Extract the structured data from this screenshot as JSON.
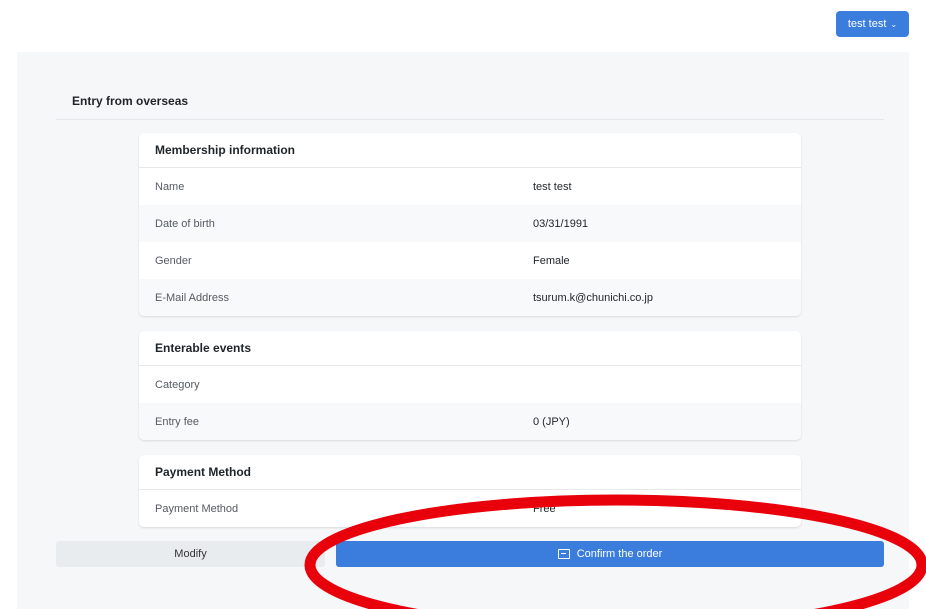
{
  "header": {
    "user_menu_label": "test test",
    "user_menu_chevron": "⌄"
  },
  "page": {
    "title": "Entry from overseas"
  },
  "membership": {
    "title": "Membership information",
    "rows": [
      {
        "label": "Name",
        "value": "test test"
      },
      {
        "label": "Date of birth",
        "value": "03/31/1991"
      },
      {
        "label": "Gender",
        "value": "Female"
      },
      {
        "label": "E-Mail Address",
        "value": "tsurum.k@chunichi.co.jp"
      }
    ]
  },
  "events": {
    "title": "Enterable events",
    "rows": [
      {
        "label": "Category",
        "value": ""
      },
      {
        "label": "Entry fee",
        "value": "0 (JPY)"
      }
    ]
  },
  "payment": {
    "title": "Payment Method",
    "rows": [
      {
        "label": "Payment Method",
        "value": "Free"
      }
    ]
  },
  "actions": {
    "modify_label": "Modify",
    "confirm_label": "Confirm the order",
    "confirm_icon": "login-icon"
  },
  "colors": {
    "accent": "#3b7ddd",
    "annotation": "#e8000b",
    "panel_bg": "#f5f7f9"
  }
}
